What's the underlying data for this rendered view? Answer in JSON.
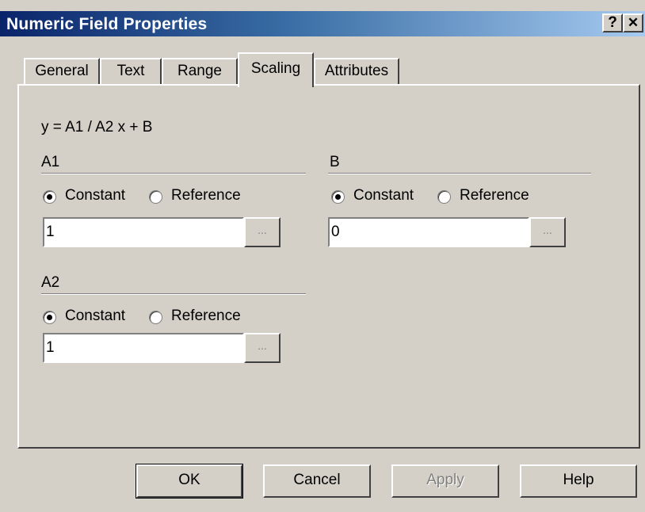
{
  "window": {
    "title": "Numeric Field Properties",
    "help_glyph": "?",
    "close_glyph": "✕"
  },
  "tabs": [
    {
      "label": "General",
      "active": false
    },
    {
      "label": "Text",
      "active": false
    },
    {
      "label": "Range",
      "active": false
    },
    {
      "label": "Scaling",
      "active": true
    },
    {
      "label": "Attributes",
      "active": false
    }
  ],
  "formula": "y = A1 / A2  x + B",
  "groups": {
    "a1": {
      "title": "A1",
      "constant_label": "Constant",
      "reference_label": "Reference",
      "selected": "Constant",
      "value": "1",
      "browse_label": "..."
    },
    "b": {
      "title": "B",
      "constant_label": "Constant",
      "reference_label": "Reference",
      "selected": "Constant",
      "value": "0",
      "browse_label": "..."
    },
    "a2": {
      "title": "A2",
      "constant_label": "Constant",
      "reference_label": "Reference",
      "selected": "Constant",
      "value": "1",
      "browse_label": "..."
    }
  },
  "buttons": {
    "ok": "OK",
    "cancel": "Cancel",
    "apply": "Apply",
    "help": "Help"
  }
}
